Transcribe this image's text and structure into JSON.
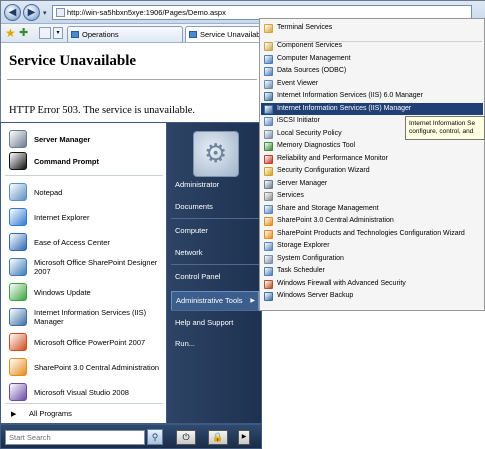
{
  "browser": {
    "url": "http://win-sa5hbxn5xye:1906/Pages/Demo.aspx",
    "tabs": [
      {
        "label": "Operations"
      },
      {
        "label": "Service Unavailable"
      }
    ]
  },
  "page": {
    "title": "Service Unavailable",
    "error": "HTTP Error 503. The service is unavailable."
  },
  "start_menu": {
    "pinned": [
      {
        "label": "Server Manager",
        "icon": "server-manager-icon",
        "color": "#6b7c90"
      },
      {
        "label": "Command Prompt",
        "icon": "command-prompt-icon",
        "color": "#111111"
      }
    ],
    "recent": [
      {
        "label": "Notepad",
        "icon": "notepad-icon",
        "color": "#5c8fc2"
      },
      {
        "label": "Internet Explorer",
        "icon": "internet-explorer-icon",
        "color": "#2f7ad1"
      },
      {
        "label": "Ease of Access Center",
        "icon": "ease-of-access-icon",
        "color": "#2e68b6"
      },
      {
        "label": "Microsoft Office SharePoint Designer 2007",
        "icon": "sharepoint-designer-icon",
        "color": "#3a7ab8"
      },
      {
        "label": "Windows Update",
        "icon": "windows-update-icon",
        "color": "#3aa341"
      },
      {
        "label": "Internet Information Services (IIS) Manager",
        "icon": "iis-manager-icon",
        "color": "#3d6fa6"
      },
      {
        "label": "Microsoft Office PowerPoint 2007",
        "icon": "powerpoint-icon",
        "color": "#d14a1b"
      },
      {
        "label": "SharePoint 3.0 Central Administration",
        "icon": "sharepoint-admin-icon",
        "color": "#e58b1b"
      },
      {
        "label": "Microsoft Visual Studio 2008",
        "icon": "visual-studio-icon",
        "color": "#6a4aa6"
      }
    ],
    "all_programs": "All Programs",
    "search_placeholder": "Start Search",
    "right_items": [
      {
        "label": "Administrator"
      },
      {
        "label": "Documents"
      },
      {
        "label": "Computer"
      },
      {
        "label": "Network"
      },
      {
        "label": "Control Panel"
      },
      {
        "label": "Administrative Tools"
      },
      {
        "label": "Help and Support"
      },
      {
        "label": "Run..."
      }
    ]
  },
  "admin_tools": [
    {
      "label": "Terminal Services",
      "color": "#d9a53a"
    },
    {
      "label": "Component Services",
      "color": "#c9a64a"
    },
    {
      "label": "Computer Management",
      "color": "#4d7db5"
    },
    {
      "label": "Data Sources (ODBC)",
      "color": "#4d7db5"
    },
    {
      "label": "Event Viewer",
      "color": "#6b8ab0"
    },
    {
      "label": "Internet Information Services (IIS) 6.0 Manager",
      "color": "#3d6fa6"
    },
    {
      "label": "Internet Information Services (IIS) Manager",
      "color": "#3d6fa6"
    },
    {
      "label": "iSCSI Initiator",
      "color": "#5a86b8"
    },
    {
      "label": "Local Security Policy",
      "color": "#7a8ea8"
    },
    {
      "label": "Memory Diagnostics Tool",
      "color": "#3d8a3d"
    },
    {
      "label": "Reliability and Performance Monitor",
      "color": "#c0392b"
    },
    {
      "label": "Security Configuration Wizard",
      "color": "#d4a020"
    },
    {
      "label": "Server Manager",
      "color": "#6b7c90"
    },
    {
      "label": "Services",
      "color": "#8c8c8c"
    },
    {
      "label": "Share and Storage Management",
      "color": "#5a86b8"
    },
    {
      "label": "SharePoint 3.0 Central Administration",
      "color": "#e58b1b"
    },
    {
      "label": "SharePoint Products and Technologies Configuration Wizard",
      "color": "#e58b1b"
    },
    {
      "label": "Storage Explorer",
      "color": "#5a86b8"
    },
    {
      "label": "System Configuration",
      "color": "#7a8ea8"
    },
    {
      "label": "Task Scheduler",
      "color": "#4d7db5"
    },
    {
      "label": "Windows Firewall with Advanced Security",
      "color": "#b5532a"
    },
    {
      "label": "Windows Server Backup",
      "color": "#3d6fa6"
    }
  ],
  "tooltip": {
    "line1": "Internet Information Se",
    "line2": "configure, control, and"
  }
}
